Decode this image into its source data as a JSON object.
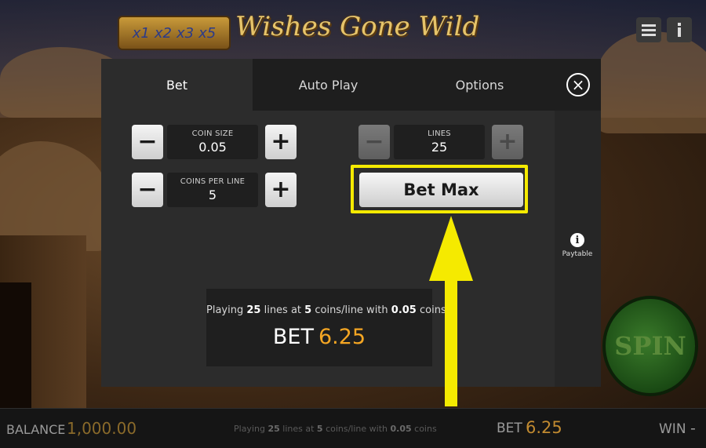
{
  "game": {
    "logo_text": "Wishes Gone Wild",
    "multipliers": [
      "x1",
      "x2",
      "x3",
      "x5"
    ]
  },
  "corner_buttons": {
    "menu_icon": "hamburger-menu-icon",
    "info_icon": "info-icon"
  },
  "modal": {
    "tabs": [
      {
        "label": "Bet",
        "active": true
      },
      {
        "label": "Auto Play",
        "active": false
      },
      {
        "label": "Options",
        "active": false
      }
    ],
    "close_symbol": "×",
    "coin_size": {
      "label": "COIN SIZE",
      "value": "0.05"
    },
    "coins_per_line": {
      "label": "COINS PER LINE",
      "value": "5"
    },
    "lines": {
      "label": "LINES",
      "value": "25"
    },
    "minus_symbol": "−",
    "plus_symbol": "+",
    "bet_max_label": "Bet Max",
    "summary": {
      "prefix": "Playing",
      "lines": "25",
      "lines_text": "lines at",
      "coins": "5",
      "coins_text": "coins/line with",
      "coin_size": "0.05",
      "coin_text": "coins",
      "bet_label": "BET",
      "bet_amount": "6.25"
    },
    "paytable_label": "Paytable",
    "paytable_icon_glyph": "i"
  },
  "spin_label": "SPIN",
  "bottom_bar": {
    "balance_label": "BALANCE",
    "balance_value": "1,000.00",
    "summary": {
      "prefix": "Playing",
      "lines": "25",
      "lines_text": "lines at",
      "coins": "5",
      "coins_text": "coins/line with",
      "coin_size": "0.05",
      "coin_text": "coins"
    },
    "bet_label": "BET",
    "bet_value": "6.25",
    "win_label": "WIN",
    "win_value": "-"
  },
  "colors": {
    "highlight": "#f5ea00",
    "bet_amount": "#f5a623"
  }
}
